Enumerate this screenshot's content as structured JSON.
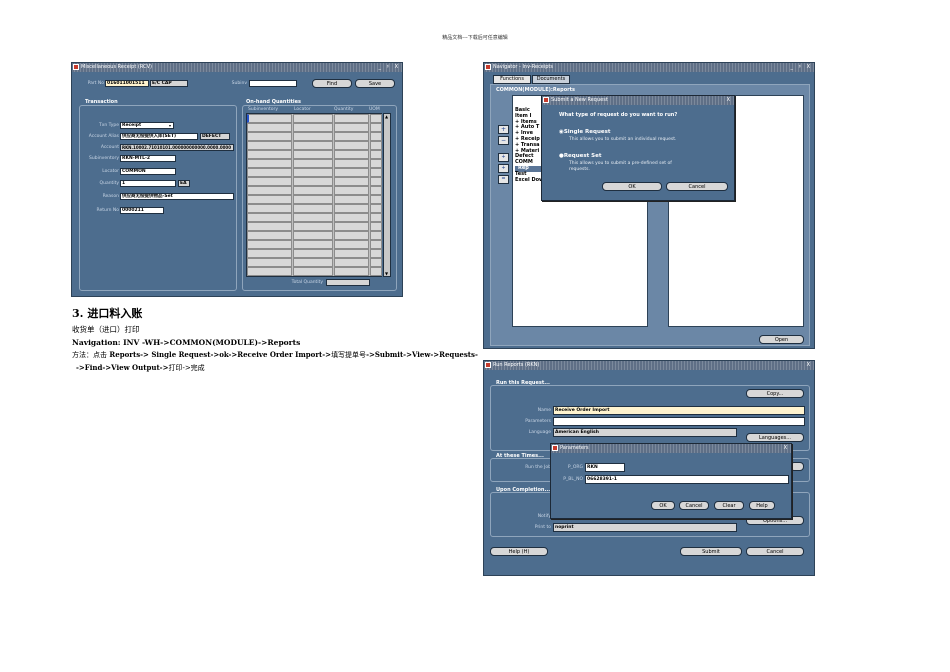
{
  "header": "精品文档---下载后可任意编辑",
  "section": {
    "heading": "3. 进口料入账",
    "line1": "收货单（进口）打印",
    "nav_label": "Navigation: INV -WH->COMMON(MODULE)->Reports",
    "method_prefix": "方法：点击",
    "method_bold1": " Reports-> Single Request->ok->Receive Order Import->",
    "method_mid": "填写提单号",
    "method_bold2": "->Submit->View->Requests-",
    "method_line2_bold": "->Find->View Output->",
    "method_end": "打印->完成"
  },
  "misc_receipt": {
    "title": "Miscellaneous Receipt (RCV)",
    "title_buttons": "_ ♯ X",
    "part_no_label": "Part No",
    "part_no": "016011001511",
    "part_desc": "E/C CAP",
    "subinv_label": "Subinv",
    "find_btn": "Find",
    "save_btn": "Save",
    "transaction_label": "Transaction",
    "onhand_label": "On-hand Quantities",
    "col_subinv": "Subinventory",
    "col_locator": "Locator",
    "col_quantity": "Quantity",
    "col_uom": "UOM",
    "txn_type_label": "Txn Type",
    "txn_type": "Receipt",
    "account_alias_label": "Account Alias",
    "account_alias": "供应商无偿提供入库(SET)",
    "account_alias_extra": "DEFECT",
    "account_label": "Account",
    "account": "RKN.10002.71010101.000000000000.0000.0000",
    "subinventory_label": "Subinventory",
    "subinventory": "RKN-MTL-2",
    "locator_label": "Locator",
    "locator": "COMMON",
    "quantity_label": "Quantity",
    "quantity": "1",
    "uom": "EA",
    "reason_label": "Reason",
    "reason": "供应商无偿提供物品-Set",
    "return_no_label": "Return No",
    "return_no": "0000211",
    "total_qty_label": "Total Quantity"
  },
  "navigator": {
    "title": "Navigator - Inv-Receipts",
    "title_buttons": "_ ♯ X",
    "tab_functions": "Functions",
    "tab_documents": "Documents",
    "path": "COMMON(MODULE):Reports",
    "tree": [
      "Basic",
      "Item I",
      "+ Items",
      "+ Auto T",
      "+ Inve",
      "+ Receip",
      "+ Transa",
      "+ Materi",
      "Defect",
      "COMM",
      "Rep",
      "Test",
      "Excel Download"
    ],
    "open_btn": "Open",
    "dialog": {
      "title": "Submit a New Request",
      "question": "What type of request do you want to run?",
      "opt1_label": "Single Request",
      "opt1_desc": "This allows you to submit an individual request.",
      "opt2_label": "Request Set",
      "opt2_desc": "This allows you to submit a pre-defined set of requests.",
      "ok_btn": "OK",
      "cancel_btn": "Cancel"
    }
  },
  "report": {
    "title": "Run Reports (RKN)",
    "close": "X",
    "run_label": "Run this Request...",
    "copy_btn": "Copy...",
    "name_label": "Name",
    "name": "Receive Order Import",
    "parameters_label": "Parameters",
    "language_label": "Language",
    "language": "American English",
    "languages_btn": "Languages...",
    "times_label": "At these Times...",
    "run_job_label": "Run the Job",
    "completion_label": "Upon Completion...",
    "notify_label": "Notify",
    "print_to_label": "Print to",
    "print_to": "noprint",
    "options_btn": "Options...",
    "help_btn": "Help (H)",
    "submit_btn": "Submit",
    "cancel_btn": "Cancel",
    "param_dialog": {
      "title": "Parameters",
      "p_org_label": "P_ORG",
      "p_org": "RKN",
      "p_bl_label": "P_BL_NO",
      "p_bl": "06628391-1",
      "ok_btn": "OK",
      "cancel_btn": "Cancel",
      "clear_btn": "Clear",
      "help_btn": "Help"
    }
  }
}
